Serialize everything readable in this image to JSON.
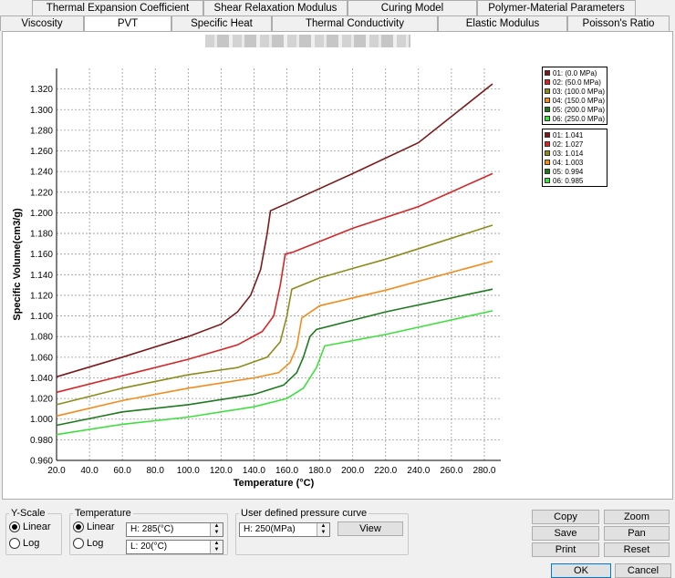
{
  "tabs_row1": [
    "Thermal Expansion Coefficient",
    "Shear Relaxation Modulus",
    "Curing Model",
    "Polymer-Material Parameters"
  ],
  "tabs_row2": [
    "Viscosity",
    "PVT",
    "Specific Heat",
    "Thermal Conductivity",
    "Elastic Modulus",
    "Poisson's Ratio"
  ],
  "active_tab": "PVT",
  "legend_pressure": [
    {
      "label": "01: (0.0 MPa)",
      "color": "#7b1a1a"
    },
    {
      "label": "02: (50.0 MPa)",
      "color": "#d42626"
    },
    {
      "label": "03: (100.0 MPa)",
      "color": "#8c8c1e"
    },
    {
      "label": "04: (150.0 MPa)",
      "color": "#f28c1c"
    },
    {
      "label": "05: (200.0 MPa)",
      "color": "#1e7a1e"
    },
    {
      "label": "06: (250.0 MPa)",
      "color": "#3ee03e"
    }
  ],
  "legend_values": [
    {
      "label": "01: 1.041",
      "color": "#7b1a1a"
    },
    {
      "label": "02: 1.027",
      "color": "#d42626"
    },
    {
      "label": "03: 1.014",
      "color": "#8c8c1e"
    },
    {
      "label": "04: 1.003",
      "color": "#f28c1c"
    },
    {
      "label": "05: 0.994",
      "color": "#1e7a1e"
    },
    {
      "label": "06: 0.985",
      "color": "#3ee03e"
    }
  ],
  "chart_data": {
    "type": "line",
    "title": "",
    "xlabel": "Temperature (°C)",
    "ylabel": "Specific Volume(cm3/g)",
    "xlim": [
      20,
      290
    ],
    "ylim": [
      0.96,
      1.34
    ],
    "xticks": [
      "20.0",
      "40.0",
      "60.0",
      "80.0",
      "100.0",
      "120.0",
      "140.0",
      "160.0",
      "180.0",
      "200.0",
      "220.0",
      "240.0",
      "260.0",
      "280.0"
    ],
    "xtick_values": [
      20,
      40,
      60,
      80,
      100,
      120,
      140,
      160,
      180,
      200,
      220,
      240,
      260,
      280
    ],
    "yticks": [
      "0.960",
      "0.980",
      "1.000",
      "1.020",
      "1.040",
      "1.060",
      "1.080",
      "1.100",
      "1.120",
      "1.140",
      "1.160",
      "1.180",
      "1.200",
      "1.220",
      "1.240",
      "1.260",
      "1.280",
      "1.300",
      "1.320"
    ],
    "ytick_values": [
      0.96,
      0.98,
      1.0,
      1.02,
      1.04,
      1.06,
      1.08,
      1.1,
      1.12,
      1.14,
      1.16,
      1.18,
      1.2,
      1.22,
      1.24,
      1.26,
      1.28,
      1.3,
      1.32
    ],
    "grid": true,
    "legend_position": "top-right",
    "series": [
      {
        "name": "01: (0.0 MPa)",
        "color": "#7b1a1a",
        "points": [
          [
            20,
            1.041
          ],
          [
            60,
            1.06
          ],
          [
            100,
            1.08
          ],
          [
            120,
            1.092
          ],
          [
            130,
            1.104
          ],
          [
            138,
            1.12
          ],
          [
            144,
            1.145
          ],
          [
            148,
            1.18
          ],
          [
            150,
            1.202
          ],
          [
            160,
            1.209
          ],
          [
            200,
            1.238
          ],
          [
            240,
            1.268
          ],
          [
            285,
            1.325
          ]
        ]
      },
      {
        "name": "02: (50.0 MPa)",
        "color": "#d42626",
        "points": [
          [
            20,
            1.026
          ],
          [
            60,
            1.042
          ],
          [
            100,
            1.058
          ],
          [
            130,
            1.072
          ],
          [
            145,
            1.085
          ],
          [
            152,
            1.1
          ],
          [
            156,
            1.13
          ],
          [
            159,
            1.16
          ],
          [
            164,
            1.162
          ],
          [
            200,
            1.185
          ],
          [
            240,
            1.206
          ],
          [
            285,
            1.238
          ]
        ]
      },
      {
        "name": "03: (100.0 MPa)",
        "color": "#8c8c1e",
        "points": [
          [
            20,
            1.014
          ],
          [
            60,
            1.03
          ],
          [
            100,
            1.043
          ],
          [
            130,
            1.05
          ],
          [
            148,
            1.06
          ],
          [
            156,
            1.075
          ],
          [
            160,
            1.1
          ],
          [
            163,
            1.126
          ],
          [
            180,
            1.137
          ],
          [
            220,
            1.155
          ],
          [
            285,
            1.188
          ]
        ]
      },
      {
        "name": "04: (150.0 MPa)",
        "color": "#f28c1c",
        "points": [
          [
            20,
            1.003
          ],
          [
            60,
            1.018
          ],
          [
            100,
            1.03
          ],
          [
            140,
            1.04
          ],
          [
            155,
            1.045
          ],
          [
            162,
            1.055
          ],
          [
            166,
            1.07
          ],
          [
            169,
            1.098
          ],
          [
            180,
            1.11
          ],
          [
            220,
            1.125
          ],
          [
            285,
            1.153
          ]
        ]
      },
      {
        "name": "05: (200.0 MPa)",
        "color": "#1e7a1e",
        "points": [
          [
            20,
            0.994
          ],
          [
            60,
            1.007
          ],
          [
            100,
            1.014
          ],
          [
            140,
            1.024
          ],
          [
            158,
            1.033
          ],
          [
            166,
            1.045
          ],
          [
            170,
            1.06
          ],
          [
            174,
            1.08
          ],
          [
            178,
            1.087
          ],
          [
            220,
            1.104
          ],
          [
            285,
            1.126
          ]
        ]
      },
      {
        "name": "06: (250.0 MPa)",
        "color": "#3ee03e",
        "points": [
          [
            20,
            0.985
          ],
          [
            60,
            0.995
          ],
          [
            100,
            1.002
          ],
          [
            140,
            1.012
          ],
          [
            160,
            1.02
          ],
          [
            170,
            1.03
          ],
          [
            178,
            1.05
          ],
          [
            183,
            1.071
          ],
          [
            220,
            1.082
          ],
          [
            285,
            1.105
          ]
        ]
      }
    ]
  },
  "yscale": {
    "label": "Y-Scale",
    "options": [
      "Linear",
      "Log"
    ],
    "selected": "Linear"
  },
  "temperature": {
    "label": "Temperature",
    "options": [
      "Linear",
      "Log"
    ],
    "selected": "Linear",
    "high": "H: 285(°C)",
    "low": "L: 20(°C)"
  },
  "pressure_curve": {
    "label": "User defined pressure curve",
    "value": "H: 250(MPa)",
    "view_label": "View"
  },
  "buttons": {
    "copy": "Copy",
    "zoom": "Zoom",
    "save": "Save",
    "pan": "Pan",
    "print": "Print",
    "reset": "Reset",
    "ok": "OK",
    "cancel": "Cancel"
  }
}
